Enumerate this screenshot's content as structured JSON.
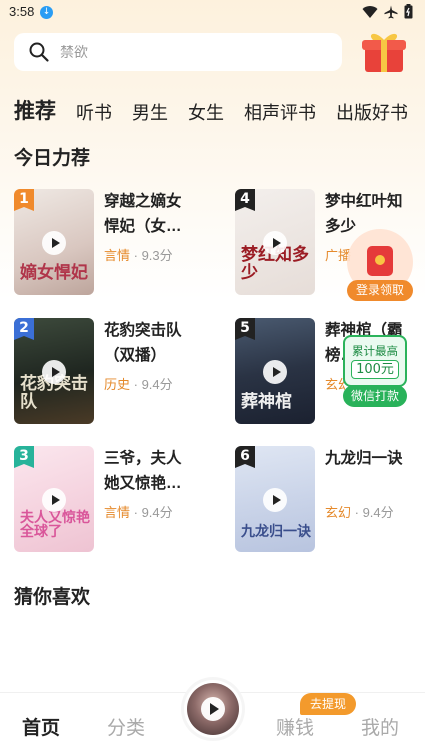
{
  "status": {
    "time": "3:58"
  },
  "search": {
    "placeholder": "禁欲"
  },
  "tabs": [
    "推荐",
    "听书",
    "男生",
    "女生",
    "相声评书",
    "出版好书"
  ],
  "sections": {
    "daily": "今日力荐",
    "guess": "猜你喜欢"
  },
  "books": [
    {
      "rank": "1",
      "title": "穿越之嫡女悍妃（女…",
      "genre": "言情",
      "score": "· 9.3分",
      "rank_color": "#f08a2c",
      "cover_text": "嫡女悍妃"
    },
    {
      "rank": "4",
      "title": "梦中红叶知多少",
      "genre": "广播",
      "score": "",
      "rank_color": "#222222",
      "cover_text": "梦红知多少"
    },
    {
      "rank": "2",
      "title": "花豹突击队（双播）",
      "genre": "历史",
      "score": "· 9.4分",
      "rank_color": "#3b6fd6",
      "cover_text": "花豹突击队"
    },
    {
      "rank": "5",
      "title": "葬神棺（霸榜…",
      "genre": "玄幻",
      "score": "",
      "rank_color": "#222222",
      "cover_text": "葬神棺"
    },
    {
      "rank": "3",
      "title": "三爷，夫人她又惊艳…",
      "genre": "言情",
      "score": "· 9.4分",
      "rank_color": "#27b39a",
      "cover_text": "夫人又惊艳全球了"
    },
    {
      "rank": "6",
      "title": "九龙归一诀",
      "genre": "玄幻",
      "score": "· 9.4分",
      "rank_color": "#222222",
      "cover_text": "九龙归一诀"
    }
  ],
  "float_redpack": {
    "label": "登录领取"
  },
  "float_wechat": {
    "line1": "累计最高",
    "amount": "100元",
    "button": "微信打款"
  },
  "bottom_nav": {
    "home": "首页",
    "category": "分类",
    "earn": "赚钱",
    "mine": "我的",
    "withdraw_badge": "去提现"
  }
}
